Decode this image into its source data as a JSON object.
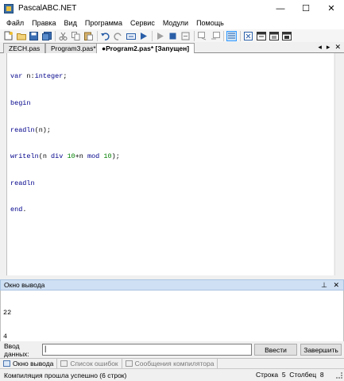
{
  "window": {
    "title": "PascalABC.NET",
    "controls": [
      "—",
      "☐",
      "✕"
    ]
  },
  "menu": [
    "Файл",
    "Правка",
    "Вид",
    "Программа",
    "Сервис",
    "Модули",
    "Помощь"
  ],
  "toolbar": {
    "icons": [
      "new-file-icon",
      "open-icon",
      "save-icon",
      "save-all-icon",
      "cut-icon",
      "copy-icon",
      "paste-icon",
      "undo-icon",
      "redo-icon",
      "compile-icon",
      "run-icon",
      "stop-icon",
      "step-icon",
      "step-into-icon",
      "comment-icon",
      "uncomment-icon",
      "format-icon",
      "debug-icon",
      "window-icon",
      "window2-icon",
      "window3-icon"
    ]
  },
  "tabs": [
    {
      "label": "ZECH.pas",
      "active": false
    },
    {
      "label": "Program3.pas*",
      "active": false
    },
    {
      "label": "●Program2.pas* [Запущен]",
      "active": true
    }
  ],
  "tab_controls": [
    "◂",
    "▸",
    "✕"
  ],
  "editor": {
    "lines": [
      "var n:integer;",
      "begin",
      "readln(n);",
      "writeln(n div 10+n mod 10);",
      "readln",
      "end."
    ]
  },
  "output_panel": {
    "title": "Окно вывода",
    "pin": "⊥",
    "close": "✕",
    "lines": [
      "22",
      "4"
    ]
  },
  "input": {
    "label": "Ввод данных:",
    "value": "|",
    "enter_button": "Ввести",
    "finish_button": "Завершить"
  },
  "bottom_tabs": [
    {
      "label": "Окно вывода",
      "active": true
    },
    {
      "label": "Список ошибок",
      "active": false
    },
    {
      "label": "Сообщения компилятора",
      "active": false
    }
  ],
  "status": {
    "message": "Компиляция прошла успешно (6 строк)",
    "position": "Строка  5  Столбец  8"
  }
}
